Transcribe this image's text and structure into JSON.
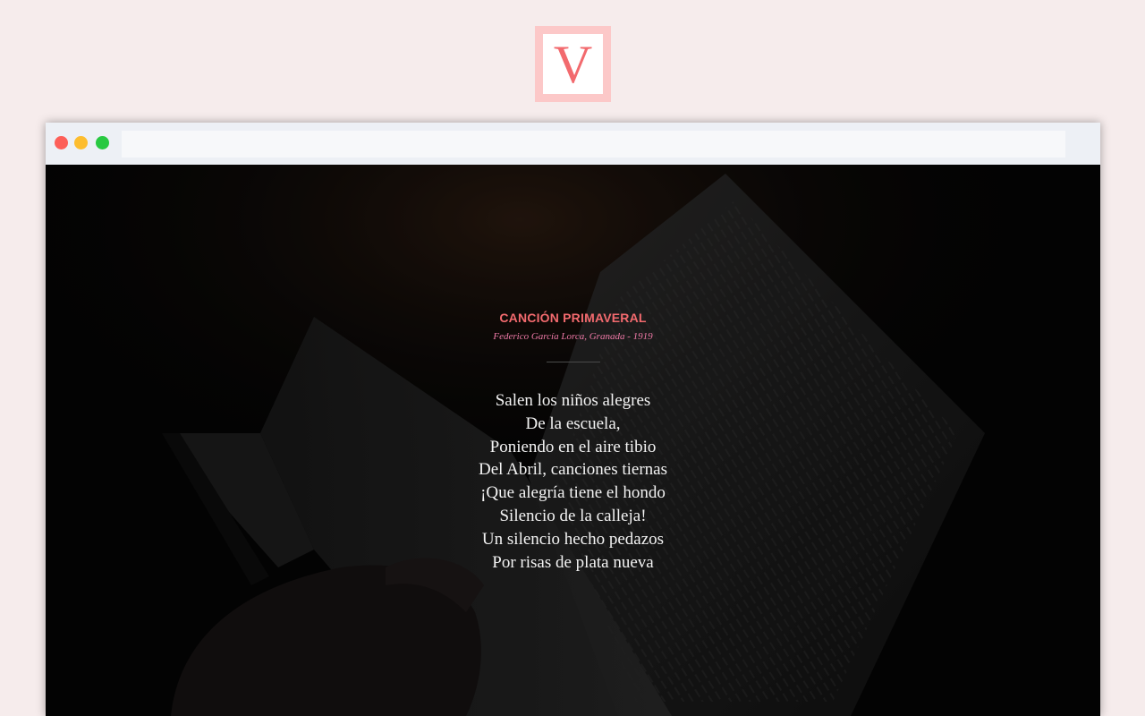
{
  "logo": {
    "letter": "V"
  },
  "browser": {
    "url": "",
    "buttons": [
      "close",
      "minimize",
      "maximize"
    ]
  },
  "poem": {
    "title": "CANCIÓN PRIMAVERAL",
    "author": "Federico García Lorca, Granada - 1919",
    "verses": [
      "Salen los niños alegres",
      "De la escuela,",
      "Poniendo en el aire tibio",
      "Del Abril, canciones tiernas",
      "¡Que alegría tiene el hondo",
      "Silencio de la calleja!",
      "Un silencio hecho pedazos",
      "Por risas de plata nueva"
    ]
  },
  "colors": {
    "background": "#f6ecec",
    "accent": "#f26a6e",
    "author": "#f07aa8",
    "logo_frame": "#fcc8c8"
  }
}
